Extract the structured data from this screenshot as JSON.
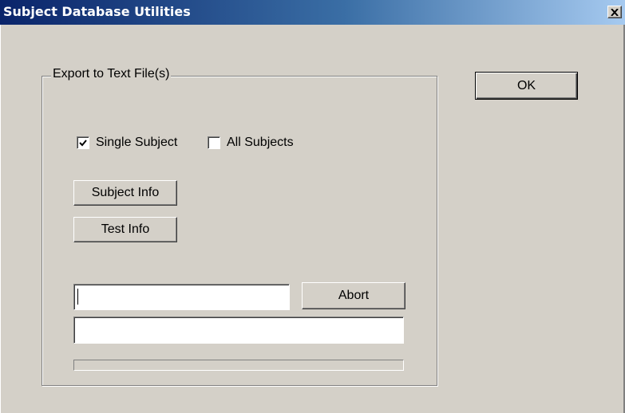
{
  "window": {
    "title": "Subject Database Utilities",
    "close_label": "✕"
  },
  "export_group": {
    "label": "Export to Text File(s)",
    "single_subject": {
      "label": "Single Subject",
      "checked": true
    },
    "all_subjects": {
      "label": "All Subjects",
      "checked": false
    },
    "subject_info_button": "Subject Info",
    "test_info_button": "Test Info",
    "status_field": {
      "value": ""
    },
    "abort_button": "Abort",
    "message_field": {
      "value": ""
    },
    "progress": {
      "fraction": 0
    }
  },
  "ok_button": "OK",
  "colors": {
    "face": "#d4d0c8",
    "title_start": "#0a246a",
    "title_end": "#a6caf0"
  }
}
